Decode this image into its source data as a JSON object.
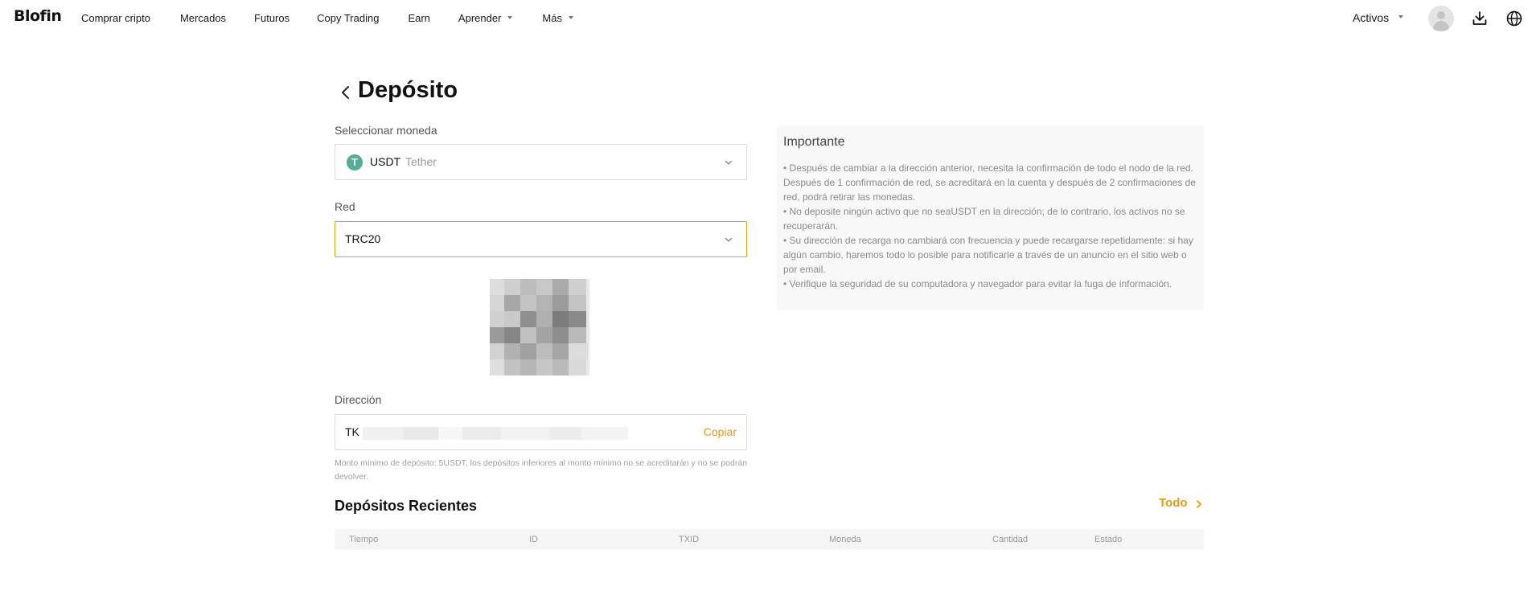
{
  "nav": {
    "logo": "Blofin",
    "links": [
      {
        "label": "Comprar cripto",
        "caret": false
      },
      {
        "label": "Mercados",
        "caret": false
      },
      {
        "label": "Futuros",
        "caret": false
      },
      {
        "label": "Copy Trading",
        "caret": false
      },
      {
        "label": "Earn",
        "caret": false
      },
      {
        "label": "Aprender",
        "caret": true
      },
      {
        "label": "Más",
        "caret": true
      }
    ],
    "assets_label": "Activos",
    "icons": [
      "avatar",
      "download-icon",
      "globe-icon"
    ]
  },
  "page": {
    "title": "Depósito"
  },
  "coin": {
    "label": "Seleccionar moneda",
    "symbol": "USDT",
    "name": "Tether",
    "icon_letter": "T",
    "icon_color": "#50af95"
  },
  "network": {
    "label": "Red",
    "value": "TRC20"
  },
  "address": {
    "label": "Dirección",
    "value": "TK",
    "copy_label": "Copiar"
  },
  "min_deposit_note": "Monto mínimo de depósito: 5USDT, los depósitos inferiores al monto mínimo no se acreditarán y no se podrán devolver.",
  "important": {
    "title": "Importante",
    "items": [
      "• Después de cambiar a la dirección anterior, necesita la confirmación de todo el nodo de la red. Después de 1 confirmación de red, se acreditará en la cuenta y después de 2 confirmaciones de red, podrá retirar las monedas.",
      "• No deposite ningún activo que no seaUSDT en la dirección; de lo contrario, los activos no se recuperarán.",
      "• Su dirección de recarga no cambiará con frecuencia y puede recargarse repetidamente: si hay algún cambio, haremos todo lo posible para notificarle a través de un anuncio en el sitio web o por email.",
      "• Verifique la seguridad de su computadora y navegador para evitar la fuga de información."
    ]
  },
  "recent": {
    "title": "Depósitos Recientes",
    "all_label": "Todo",
    "columns": [
      "Tiempo",
      "ID",
      "TXID",
      "Moneda",
      "Cantidad",
      "Estado"
    ]
  },
  "colors": {
    "accent": "#e89b0c",
    "active_border": "#f0a000",
    "tether": "#50af95"
  }
}
